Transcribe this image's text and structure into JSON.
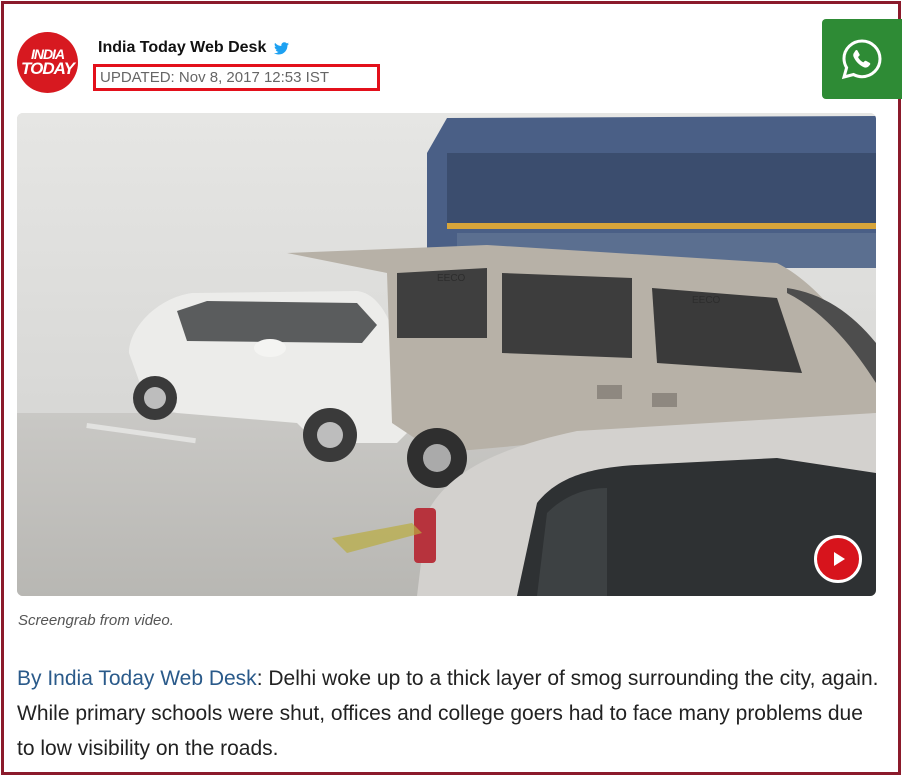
{
  "header": {
    "logo_line1": "INDIA",
    "logo_line2": "TODAY",
    "author_name": "India Today Web Desk",
    "updated": "UPDATED: Nov 8, 2017 12:53 IST"
  },
  "media": {
    "caption": "Screengrab from video.",
    "van_badge1": "EECO",
    "van_badge2": "EECO"
  },
  "article": {
    "byline_link": "By India Today Web Desk",
    "body_text": ": Delhi woke up to a thick layer of smog surrounding the city, again. While primary schools were shut, offices and college goers had to face many problems due to low visibility on the roads."
  },
  "colors": {
    "frame": "#8b1a2b",
    "logo": "#d71920",
    "whatsapp": "#2e8b35",
    "play": "#d7141c",
    "link": "#2a5a8a",
    "highlight_box": "#e3101b"
  },
  "icons": [
    "twitter-bird-icon",
    "whatsapp-icon",
    "play-icon"
  ]
}
